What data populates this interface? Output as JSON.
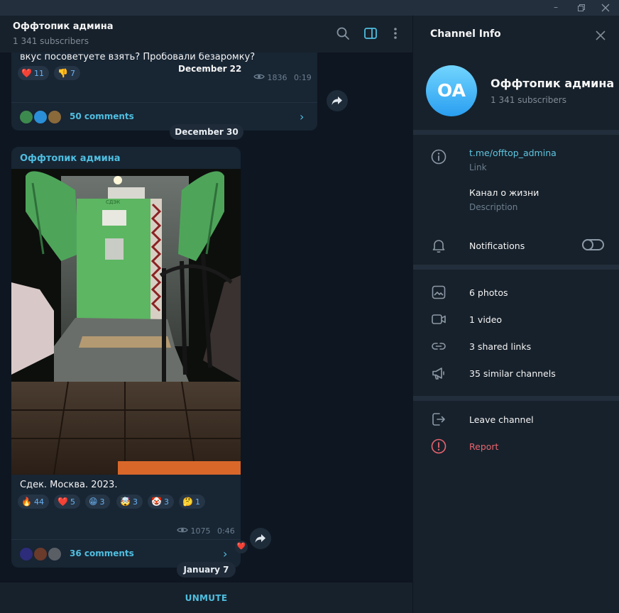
{
  "chat": {
    "title": "Оффтопик админа",
    "subscribers": "1 341 subscribers",
    "post1": {
      "text": "вкус посоветуете взять? Пробовали безаромку?",
      "reactions": [
        {
          "emoji": "❤️",
          "count": "11"
        },
        {
          "emoji": "👎",
          "count": "7"
        }
      ],
      "date_label": "December 22",
      "views": "1836",
      "time": "0:19",
      "comments": "50 comments"
    },
    "date_pill_1": "December 30",
    "post2": {
      "author": "Оффтопик админа",
      "caption": "Сдек. Москва. 2023.",
      "reactions": [
        {
          "emoji": "🔥",
          "count": "44"
        },
        {
          "emoji": "❤️",
          "count": "5"
        },
        {
          "emoji": "😁",
          "count": "3"
        },
        {
          "emoji": "🤯",
          "count": "3"
        },
        {
          "emoji": "🤡",
          "count": "3"
        },
        {
          "emoji": "🤔",
          "count": "1"
        }
      ],
      "views": "1075",
      "time": "0:46",
      "comments": "36 comments",
      "side_reaction": "❤️",
      "photo_sign": "СДЭК"
    },
    "date_pill_2": "January 7",
    "unmute": "UNMUTE"
  },
  "panel": {
    "title": "Channel Info",
    "avatar_initials": "OA",
    "name": "Оффтопик админа",
    "subscribers": "1 341 subscribers",
    "link": "t.me/offtop_admina",
    "link_label": "Link",
    "description": "Канал о жизни",
    "description_label": "Description",
    "notifications": "Notifications",
    "media": [
      {
        "label": "6 photos"
      },
      {
        "label": "1 video"
      },
      {
        "label": "3 shared links"
      },
      {
        "label": "35 similar channels"
      }
    ],
    "leave": "Leave channel",
    "report": "Report"
  },
  "colors": {
    "accent": "#4fbee0",
    "link": "#5fc6e0",
    "danger": "#e8646f",
    "chat_bg": "#0e1621",
    "panel_bg": "#17212b",
    "bubble": "#182533"
  },
  "icons": [
    "search-icon",
    "sidebar-toggle-icon",
    "more-vertical-icon",
    "close-icon",
    "info-icon",
    "bell-icon",
    "photo-icon",
    "video-icon",
    "link-icon",
    "megaphone-icon",
    "leave-icon",
    "report-icon",
    "eye-icon",
    "share-icon",
    "chevron-right-icon"
  ]
}
